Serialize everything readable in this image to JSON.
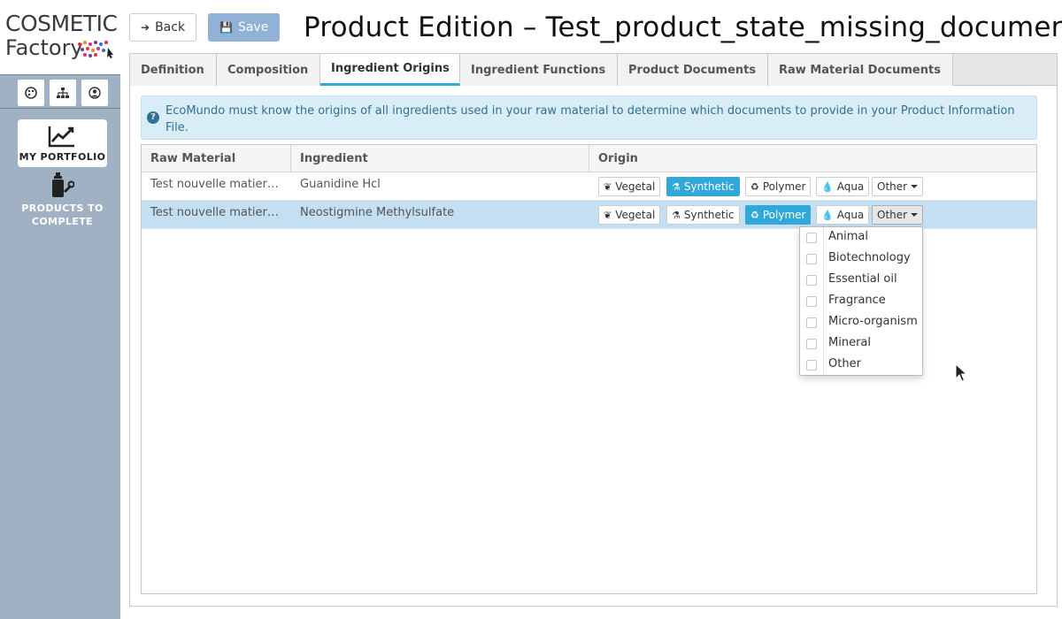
{
  "app": {
    "logo_line1": "COSMETIC",
    "logo_line2": "Factory",
    "brand_colors": [
      "#e8303a",
      "#f08a1c",
      "#6b3fa0",
      "#d92a8c",
      "#2a6fd9",
      "#e8303a"
    ]
  },
  "sidebar": {
    "icons": [
      "palette-icon",
      "sitemap-icon",
      "user-circle-icon"
    ],
    "portfolio_label": "MY PORTFOLIO",
    "complete_label": "PRODUCTS TO COMPLETE"
  },
  "toolbar": {
    "back_label": "Back",
    "save_label": "Save"
  },
  "page_title": "Product Edition – Test_product_state_missing_document",
  "tabs": [
    {
      "label": "Definition"
    },
    {
      "label": "Composition"
    },
    {
      "label": "Ingredient Origins"
    },
    {
      "label": "Ingredient Functions"
    },
    {
      "label": "Product Documents"
    },
    {
      "label": "Raw Material Documents"
    }
  ],
  "active_tab": "Ingredient Origins",
  "info_text": "EcoMundo must know the origins of all ingredients used in your raw material to determine which documents to provide in your Product Information File.",
  "table": {
    "columns": [
      "Raw Material",
      "Ingredient",
      "Origin"
    ],
    "origin_options": [
      "Vegetal",
      "Synthetic",
      "Polymer",
      "Aqua",
      "Other"
    ],
    "rows": [
      {
        "raw_material": "Test nouvelle matier…",
        "ingredient": "Guanidine Hcl",
        "active_origin": "Synthetic"
      },
      {
        "raw_material": "Test nouvelle matier…",
        "ingredient": "Neostigmine Methylsulfate",
        "active_origin": "Polymer"
      }
    ]
  },
  "dropdown": {
    "items": [
      "Animal",
      "Biotechnology",
      "Essential oil",
      "Fragrance",
      "Micro-organism",
      "Mineral",
      "Other"
    ]
  },
  "colors": {
    "accent": "#31a8d8",
    "sidebar": "#9fb1c3",
    "info_bg": "#d9edf7",
    "info_text": "#31708f",
    "selected_row": "#c4dff2",
    "save_button": "#8fb2d6"
  }
}
